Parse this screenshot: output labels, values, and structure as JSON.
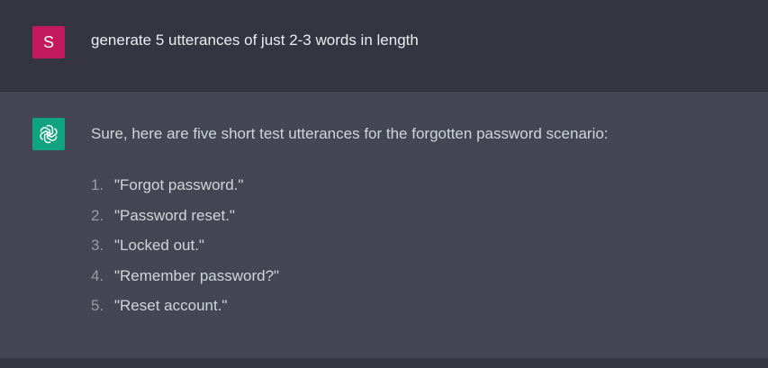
{
  "user_message": {
    "avatar_letter": "S",
    "avatar_color": "#c31a5d",
    "text": "generate 5 utterances of just 2-3 words in length"
  },
  "assistant_message": {
    "avatar_icon": "openai-logo-icon",
    "avatar_color": "#10a37f",
    "intro": "Sure, here are five short test utterances for the forgotten password scenario:",
    "items": [
      {
        "number": "1.",
        "text": "\"Forgot password.\""
      },
      {
        "number": "2.",
        "text": "\"Password reset.\""
      },
      {
        "number": "3.",
        "text": "\"Locked out.\""
      },
      {
        "number": "4.",
        "text": "\"Remember password?\""
      },
      {
        "number": "5.",
        "text": "\"Reset account.\""
      }
    ]
  }
}
